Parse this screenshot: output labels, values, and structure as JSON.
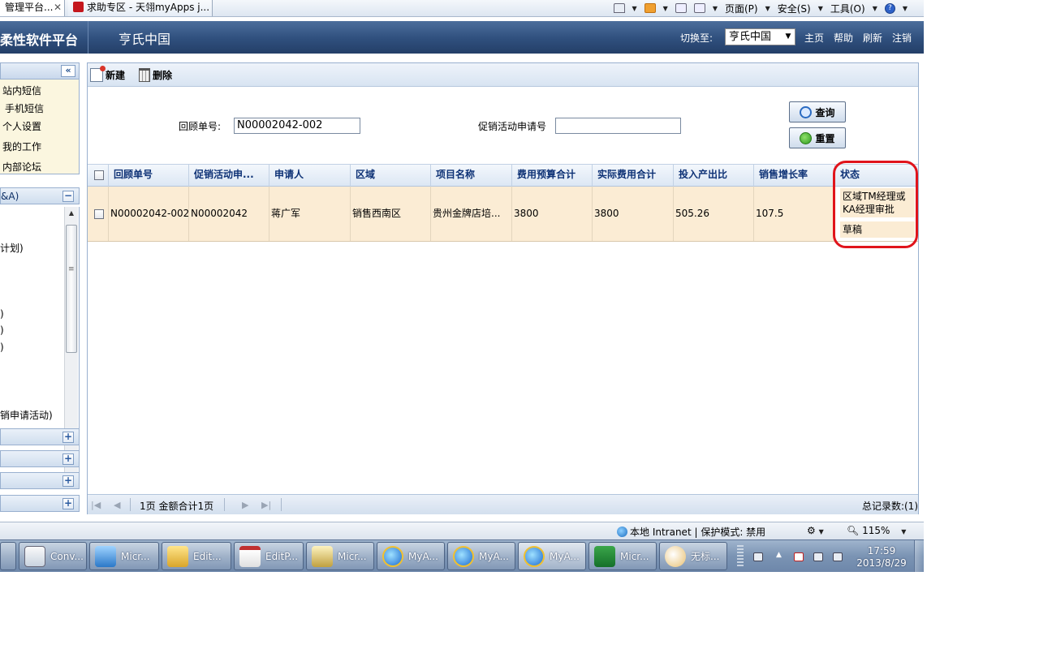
{
  "browser": {
    "tabs": [
      {
        "label": "管理平台..."
      },
      {
        "label": "求助专区 - 天翎myApps j..."
      }
    ],
    "commands": {
      "page": "页面(P)",
      "safety": "安全(S)",
      "tools": "工具(O)"
    }
  },
  "header": {
    "brand": "柔性软件平台",
    "company": "亨氏中国",
    "switch_label": "切换至:",
    "switch_value": "亨氏中国",
    "links": [
      "主页",
      "帮助",
      "刷新",
      "注销"
    ]
  },
  "sidebar": {
    "quick_items": [
      "站内短信",
      "手机短信",
      "个人设置",
      "我的工作",
      "内部论坛"
    ],
    "tree_header": "&A)",
    "tree_fragments": [
      "计划)",
      ")",
      ")",
      ")",
      "销申请活动)"
    ]
  },
  "toolbar": {
    "new_label": "新建",
    "delete_label": "删除"
  },
  "search": {
    "review_no_label": "回顾单号:",
    "review_no_value": "N00002042-002",
    "apply_no_label": "促销活动申请号",
    "apply_no_value": "",
    "query_label": "查询",
    "reset_label": "重置"
  },
  "grid": {
    "columns": [
      "回顾单号",
      "促销活动申...",
      "申请人",
      "区域",
      "项目名称",
      "费用预算合计",
      "实际费用合计",
      "投入产出比",
      "销售增长率",
      "状态"
    ],
    "rows": [
      {
        "review_no": "N00002042-002",
        "apply_no": "N00002042",
        "applicant": "蒋广军",
        "region": "销售西南区",
        "project": "贵州金牌店培...",
        "budget_total": "3800",
        "actual_total": "3800",
        "roi": "505.26",
        "growth": "107.5",
        "status_lines": [
          "区域TM经理或KA经理审批",
          "草稿"
        ]
      }
    ]
  },
  "pager": {
    "text": "1页 金额合计1页",
    "total": "总记录数:(1)"
  },
  "statusbar": {
    "zone": "本地 Intranet | 保护模式: 禁用",
    "zoom": "115%"
  },
  "taskbar": {
    "items": [
      {
        "label": "",
        "icon": "app-icon"
      },
      {
        "label": "Conv...",
        "icon": "conversation-icon"
      },
      {
        "label": "Micr...",
        "icon": "messenger-icon"
      },
      {
        "label": "Edit...",
        "icon": "folder-icon"
      },
      {
        "label": "EditP...",
        "icon": "editplus-icon"
      },
      {
        "label": "Micr...",
        "icon": "tool-icon"
      },
      {
        "label": "MyA...",
        "icon": "ie-icon"
      },
      {
        "label": "MyA...",
        "icon": "ie-icon"
      },
      {
        "label": "MyA...",
        "icon": "ie-icon"
      },
      {
        "label": "Micr...",
        "icon": "excel-icon"
      },
      {
        "label": "无标...",
        "icon": "paint-icon"
      }
    ],
    "clock_time": "17:59",
    "clock_date": "2013/8/29"
  }
}
